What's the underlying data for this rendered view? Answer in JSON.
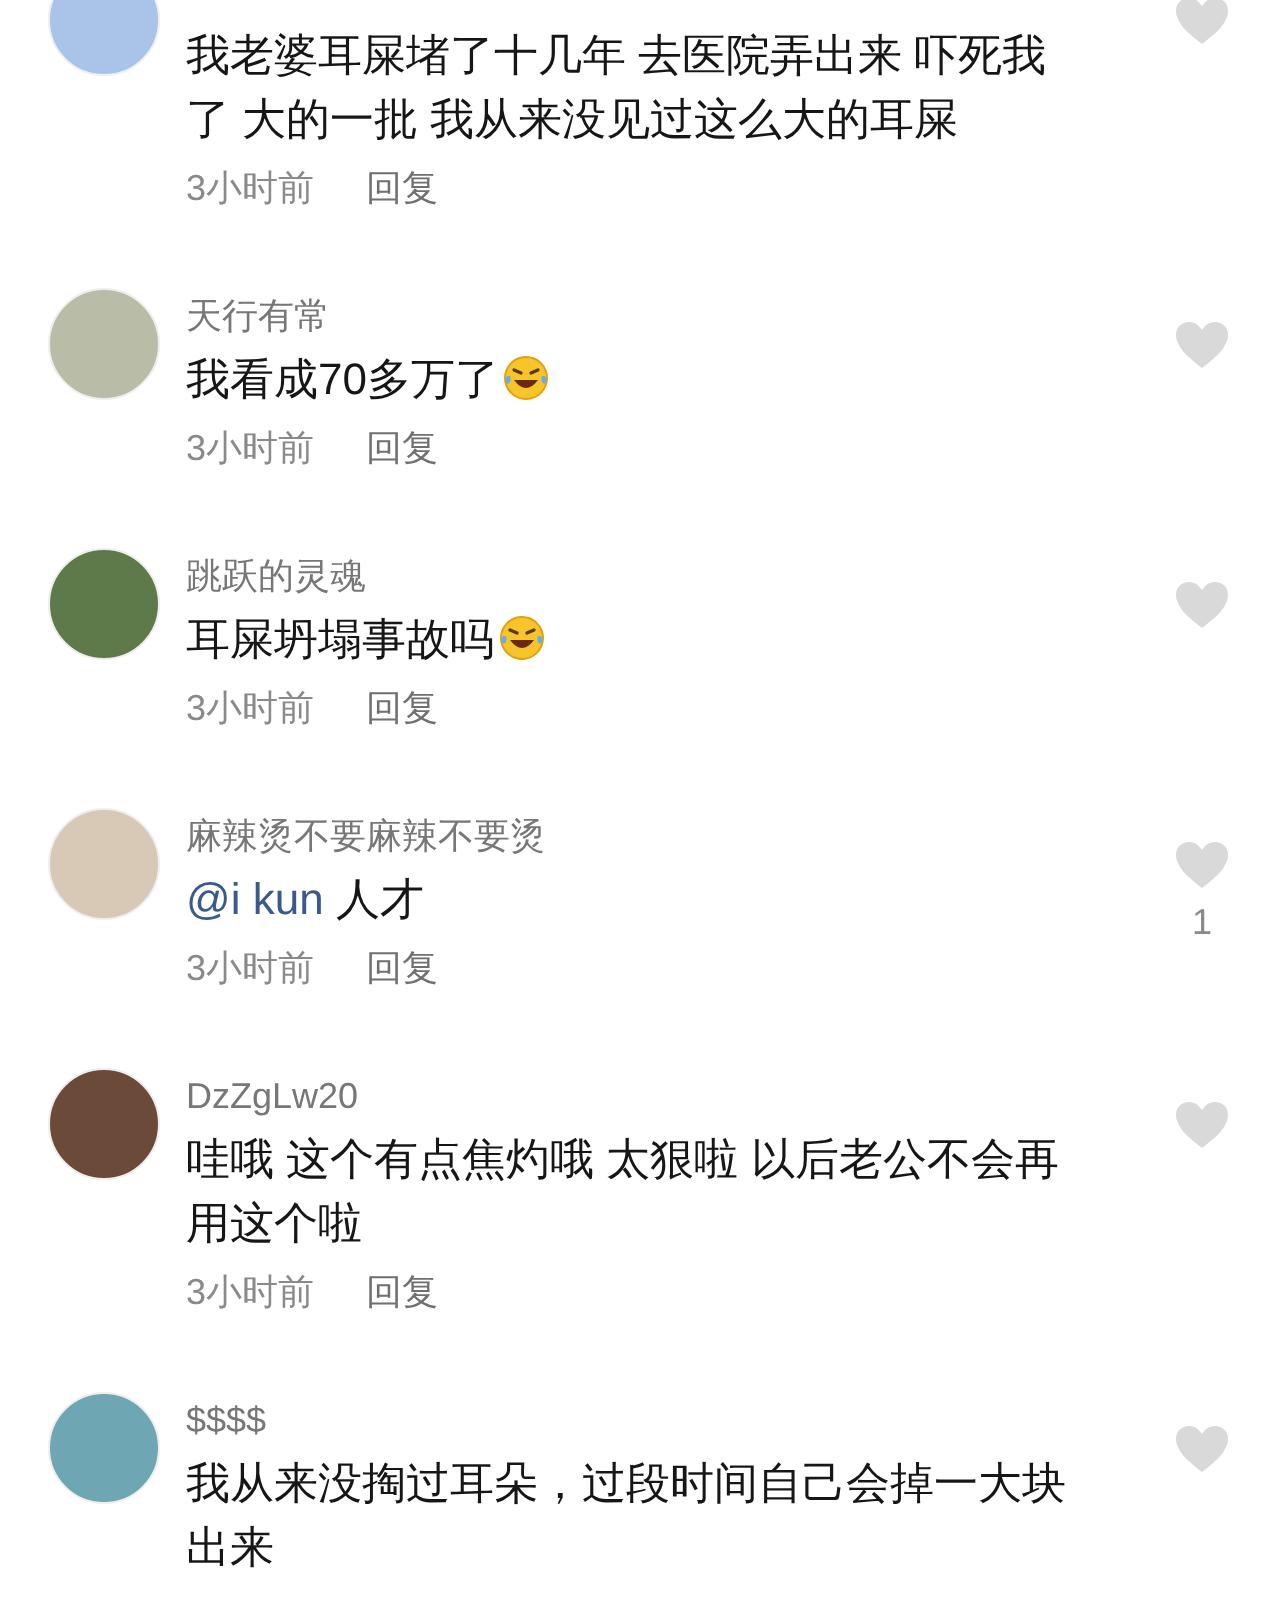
{
  "comments": [
    {
      "kind": "plain",
      "lines": [
        "我老婆耳屎堵了十几年 去医院弄出来 吓死我",
        "了 大的一批 我从来没见过这么大的耳屎"
      ],
      "time": "3小时前",
      "reply": "回复"
    },
    {
      "kind": "emoji",
      "username": "天行有常",
      "lines": [
        "我看成70多万了"
      ],
      "time": "3小时前",
      "reply": "回复"
    },
    {
      "kind": "emoji",
      "username": "跳跃的灵魂",
      "lines": [
        "耳屎坍塌事故吗"
      ],
      "time": "3小时前",
      "reply": "回复"
    },
    {
      "kind": "plain",
      "username": "麻辣烫不要麻辣不要烫",
      "mention": "@i kun",
      "lines": [
        "人才"
      ],
      "time": "3小时前",
      "reply": "回复",
      "likes": "1"
    },
    {
      "kind": "plain",
      "username": "DzZgLw20",
      "lines": [
        "哇哦 这个有点焦灼哦 太狠啦 以后老公不会再",
        "用这个啦"
      ],
      "time": "3小时前",
      "reply": "回复"
    },
    {
      "kind": "plain",
      "username": "$$$$",
      "lines": [
        "我从来没掏过耳朵，过段时间自己会掉一大块",
        "出来"
      ]
    }
  ]
}
